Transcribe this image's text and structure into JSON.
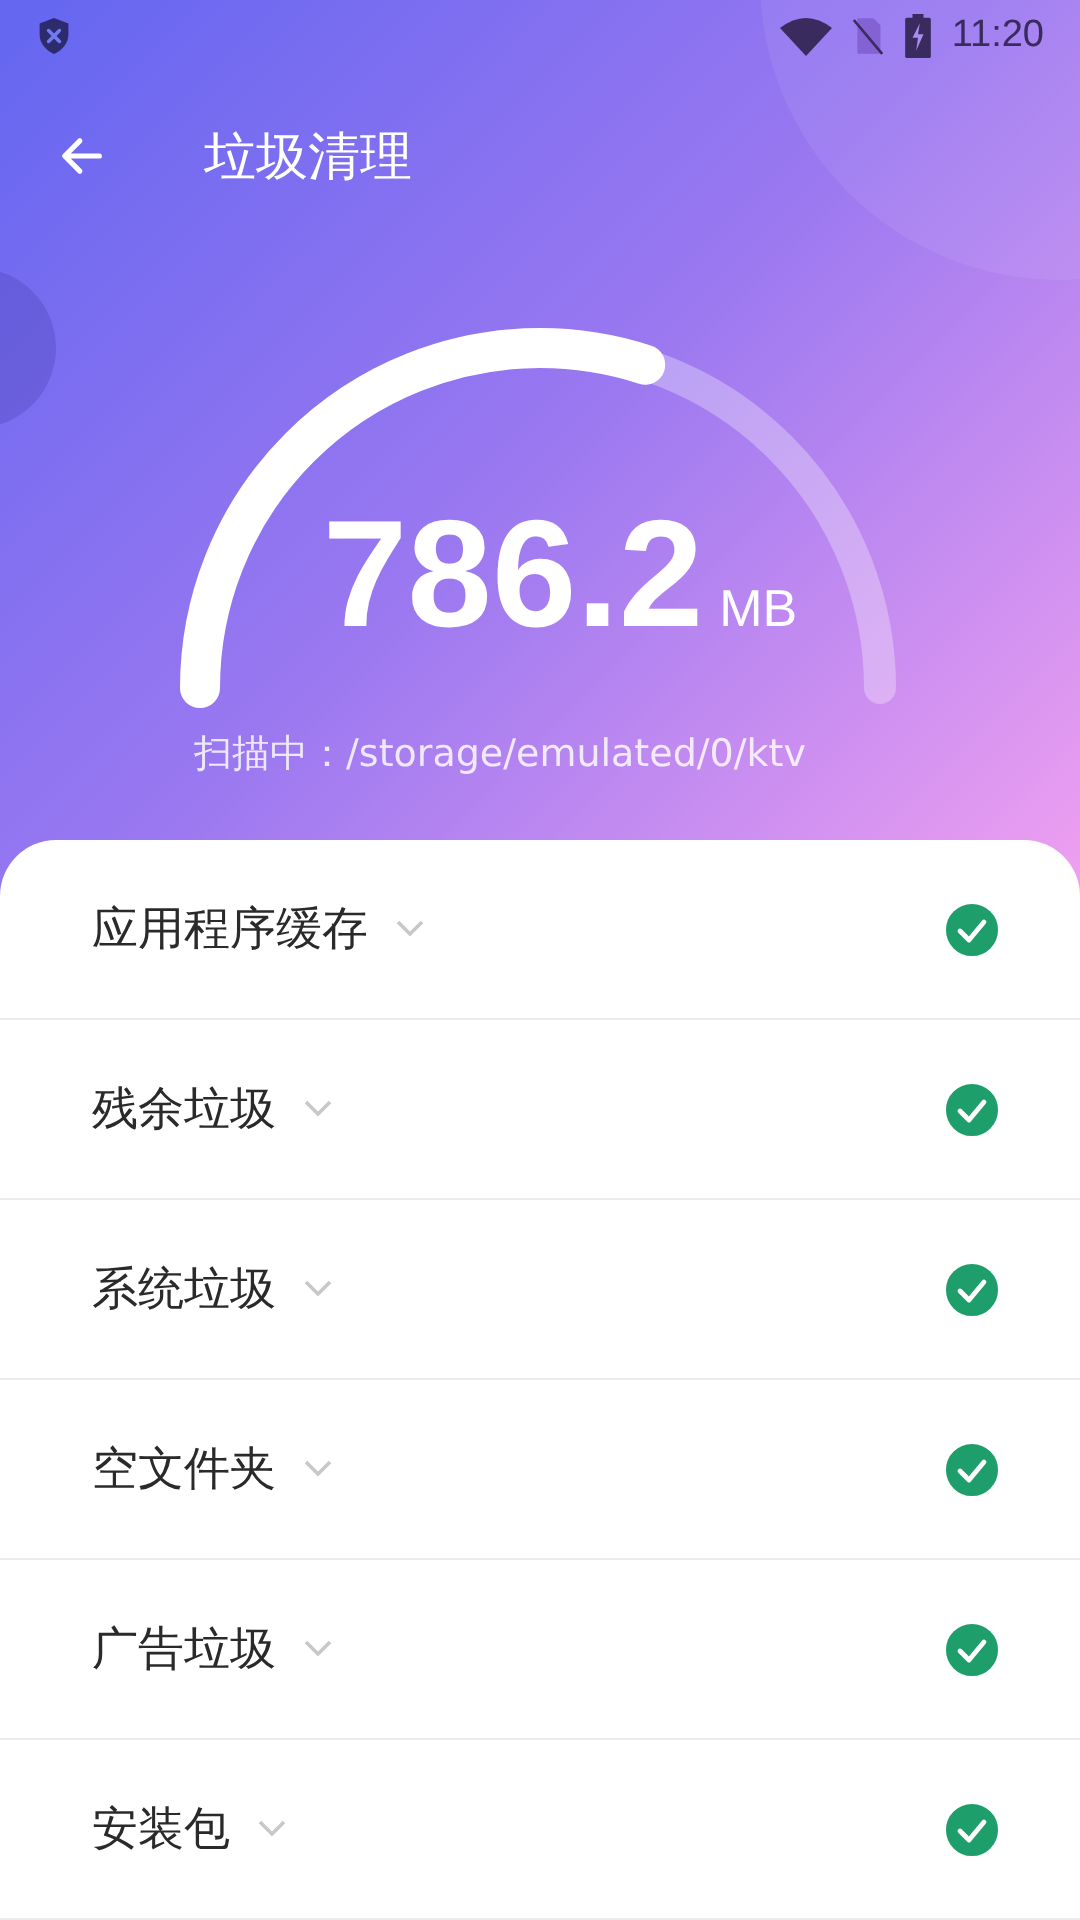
{
  "status_bar": {
    "time": "11:20"
  },
  "toolbar": {
    "title": "垃圾清理"
  },
  "gauge": {
    "value": "786.2",
    "unit": "MB"
  },
  "scan_path": "扫描中：/storage/emulated/0/ktv",
  "categories": [
    {
      "label": "应用程序缓存",
      "checked": true
    },
    {
      "label": "残余垃圾",
      "checked": true
    },
    {
      "label": "系统垃圾",
      "checked": true
    },
    {
      "label": "空文件夹",
      "checked": true
    },
    {
      "label": "广告垃圾",
      "checked": true
    },
    {
      "label": "安装包",
      "checked": true
    }
  ]
}
